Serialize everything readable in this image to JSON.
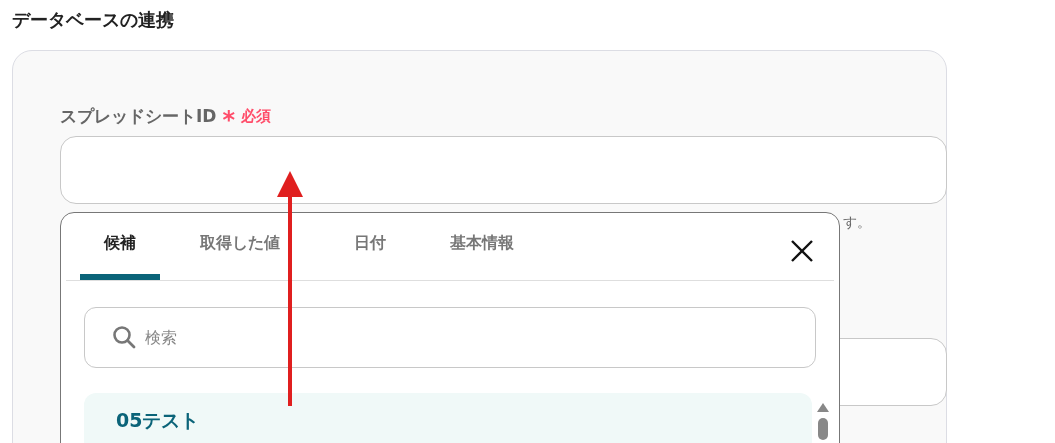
{
  "section_title": "データベースの連携",
  "field": {
    "label": "スプレッドシートID",
    "required_mark": "*",
    "required_text": "必須",
    "hint": "す。"
  },
  "popup": {
    "tabs": [
      {
        "label": "候補",
        "selected": true
      },
      {
        "label": "取得した値",
        "selected": false
      },
      {
        "label": "日付",
        "selected": false
      },
      {
        "label": "基本情報",
        "selected": false
      }
    ],
    "search": {
      "placeholder": "検索"
    },
    "items": [
      {
        "label": "05テスト",
        "selected": true
      }
    ]
  }
}
